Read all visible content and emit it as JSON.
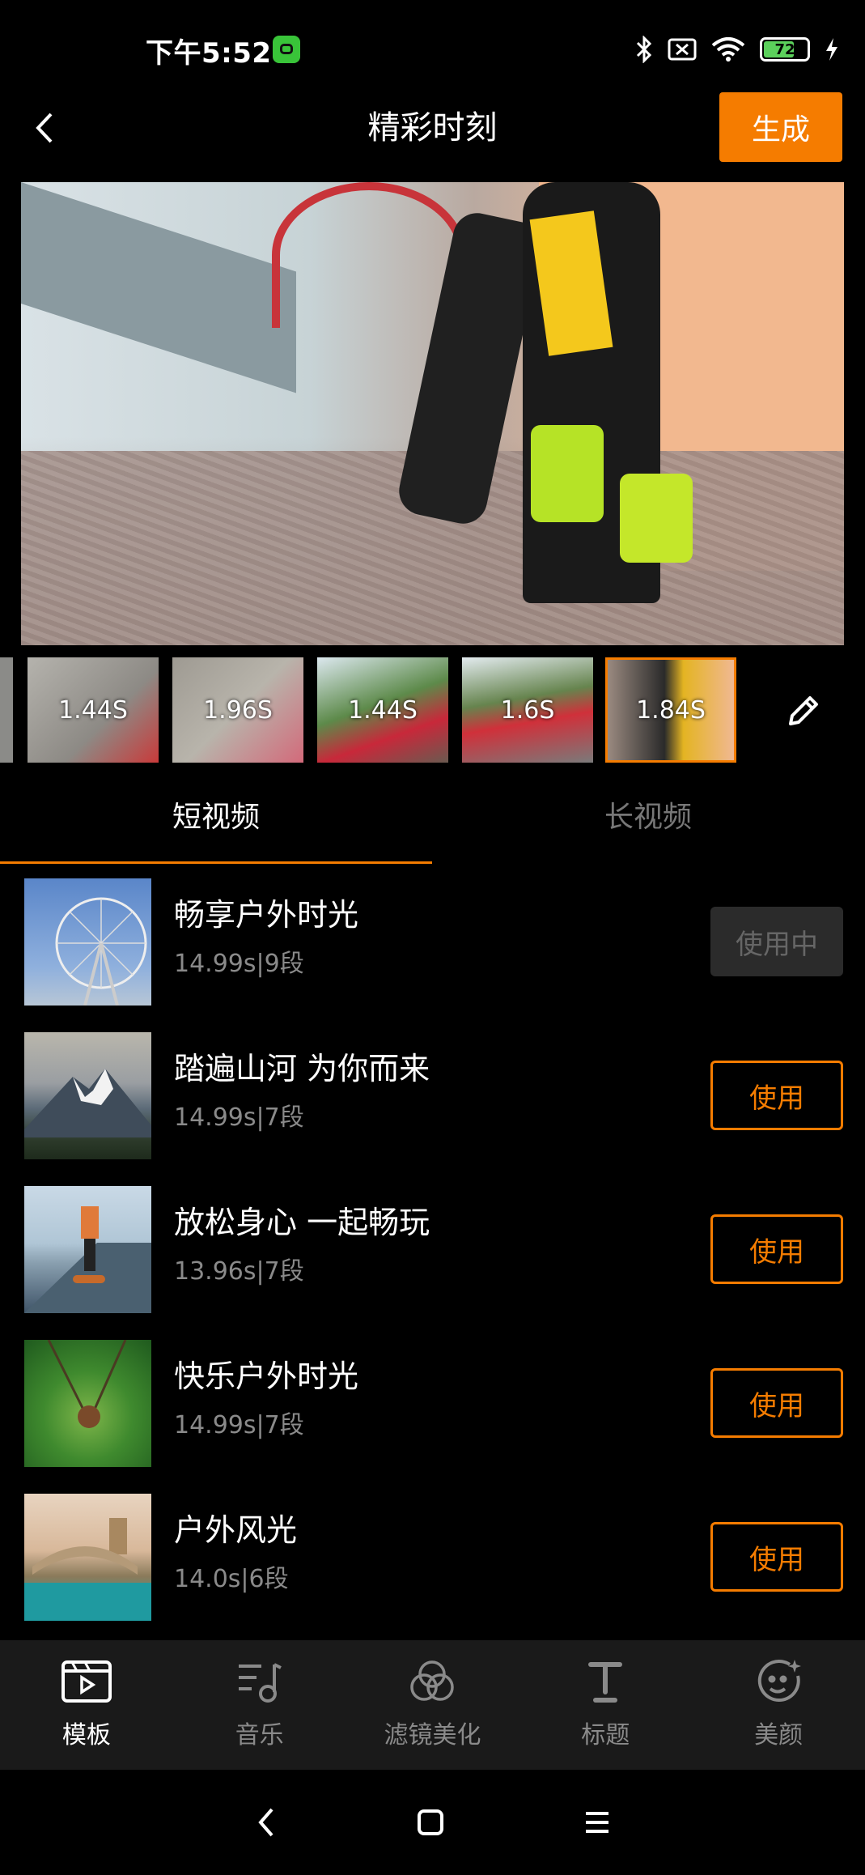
{
  "status_bar": {
    "time": "下午5:52",
    "battery": "72"
  },
  "header": {
    "title": "精彩时刻",
    "generate_label": "生成"
  },
  "clips": [
    {
      "duration": "1.44S"
    },
    {
      "duration": "1.96S"
    },
    {
      "duration": "1.44S"
    },
    {
      "duration": "1.6S"
    },
    {
      "duration": "1.84S"
    }
  ],
  "tabs": {
    "short": "短视频",
    "long": "长视频"
  },
  "templates": [
    {
      "title": "畅享户外时光",
      "meta": "14.99s|9段",
      "button": "使用中",
      "active": true
    },
    {
      "title": "踏遍山河 为你而来",
      "meta": "14.99s|7段",
      "button": "使用",
      "active": false
    },
    {
      "title": "放松身心 一起畅玩",
      "meta": "13.96s|7段",
      "button": "使用",
      "active": false
    },
    {
      "title": "快乐户外时光",
      "meta": "14.99s|7段",
      "button": "使用",
      "active": false
    },
    {
      "title": "户外风光",
      "meta": "14.0s|6段",
      "button": "使用",
      "active": false
    }
  ],
  "bottom_nav": [
    {
      "label": "模板",
      "icon": "template-icon"
    },
    {
      "label": "音乐",
      "icon": "music-icon"
    },
    {
      "label": "滤镜美化",
      "icon": "filter-icon"
    },
    {
      "label": "标题",
      "icon": "title-icon"
    },
    {
      "label": "美颜",
      "icon": "beauty-icon"
    }
  ],
  "colors": {
    "accent": "#f57c00",
    "background": "#000000",
    "nav_bg": "#1a1a1a"
  }
}
